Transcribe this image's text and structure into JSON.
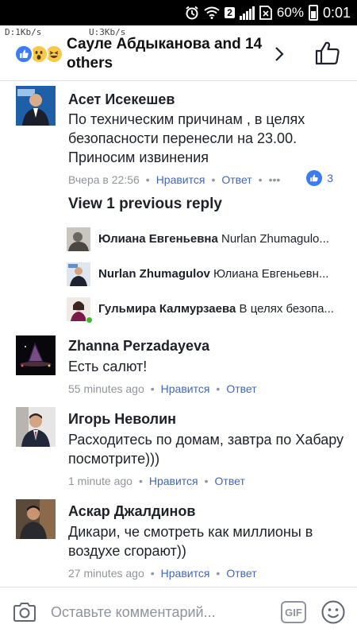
{
  "status_bar": {
    "battery": "60%",
    "time": "0:01",
    "network_badge": "2"
  },
  "netspeed": {
    "down": "D:1Kb/s",
    "up": "U:3Kb/s"
  },
  "header": {
    "title": "Сауле Абдыканова and 14 others"
  },
  "comments": [
    {
      "name": "Асет Исекешев",
      "text": "По техническим причинам , в целях безопасности перенесли на 23.00. Приносим извинения",
      "time": "Вчера в 22:56",
      "like": "Нравится",
      "reply": "Ответ",
      "like_count": "3"
    },
    {
      "name": "Zhanna Perzadayeva",
      "text": "Есть салют!",
      "time": "55 minutes ago",
      "like": "Нравится",
      "reply": "Ответ"
    },
    {
      "name": "Игорь Неволин",
      "text": "Расходитесь по домам, завтра по Хабару посмотрите)))",
      "time": "1 minute ago",
      "like": "Нравится",
      "reply": "Ответ"
    },
    {
      "name": "Аскар Джалдинов",
      "text": "Дикари, че смотреть как миллионы в воздухе сгорают))",
      "time": "27 minutes ago",
      "like": "Нравится",
      "reply": "Ответ"
    }
  ],
  "view_previous": "View 1 previous reply",
  "replies": [
    {
      "name": "Юлиана Евгеньевна",
      "text": "Nurlan Zhumagulo..."
    },
    {
      "name": "Nurlan Zhumagulov",
      "text": "Юлиана Евгеньевн..."
    },
    {
      "name": "Гульмира Калмурзаева",
      "text": "В целях безопа..."
    }
  ],
  "composer": {
    "placeholder": "Оставьте комментарий...",
    "gif_label": "GIF"
  },
  "colors": {
    "accent": "#4267b2",
    "meta": "#90949c",
    "like_blue": "#3b7cf4"
  }
}
